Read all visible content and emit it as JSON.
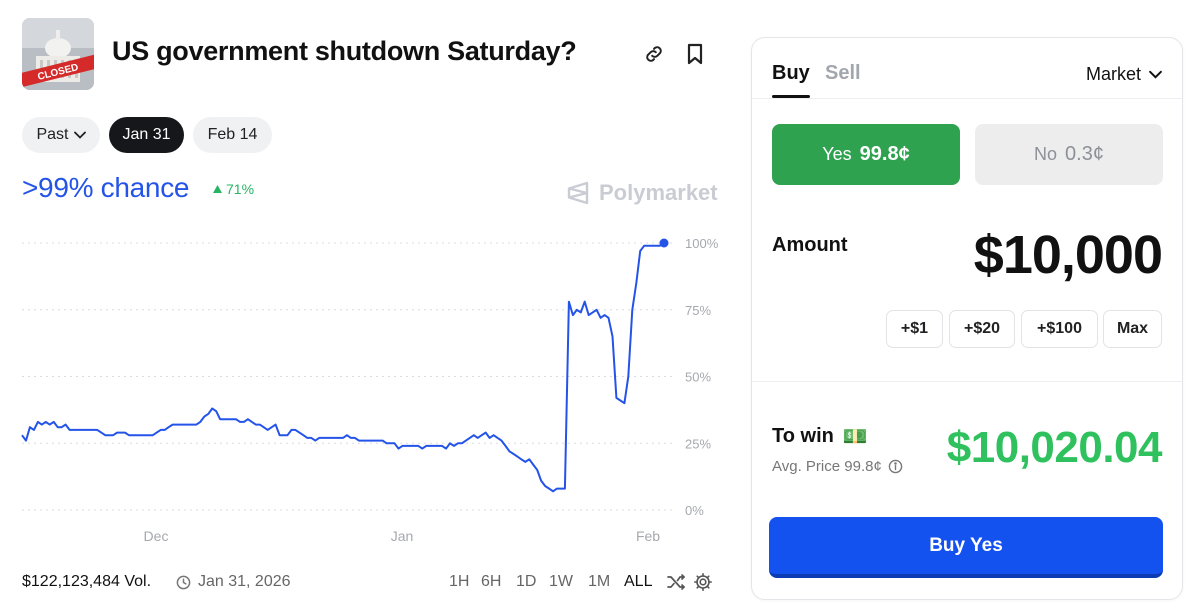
{
  "market": {
    "title": "US government shutdown Saturday?",
    "thumbnail_stamp": "CLOSED"
  },
  "date_pills": [
    {
      "label": "Past",
      "has_dropdown": true,
      "active": false
    },
    {
      "label": "Jan 31",
      "active": true
    },
    {
      "label": "Feb 14",
      "active": false
    }
  ],
  "probability": {
    "chance_text": ">99% chance",
    "change_text": "71%",
    "change_direction": "up"
  },
  "watermark": "Polymarket",
  "chart_data": {
    "type": "line",
    "x_ticks": [
      "Dec",
      "Jan",
      "Feb"
    ],
    "y_ticks": [
      "100%",
      "75%",
      "50%",
      "25%",
      "0%"
    ],
    "ylim": [
      0,
      100
    ],
    "grid": true,
    "legend": "none",
    "series": [
      {
        "color": "#2453e8",
        "values": [
          28,
          26,
          31,
          30,
          33,
          32,
          33,
          32,
          33,
          31,
          31,
          32,
          30,
          30,
          30,
          30,
          30,
          30,
          30,
          30,
          29,
          28,
          28,
          28,
          29,
          29,
          29,
          28,
          28,
          28,
          28,
          28,
          28,
          28,
          29,
          30,
          30,
          31,
          32,
          32,
          32,
          32,
          32,
          32,
          32,
          33,
          35,
          36,
          38,
          37,
          34,
          34,
          34,
          34,
          34,
          33,
          33,
          34,
          33,
          32,
          32,
          31,
          30,
          31,
          32,
          28,
          28,
          28,
          30,
          30,
          29,
          28,
          27,
          27,
          26,
          27,
          27,
          27,
          27,
          27,
          27,
          27,
          28,
          27,
          27,
          26,
          26,
          26,
          26,
          26,
          26,
          26,
          25,
          25,
          25,
          23,
          24,
          24,
          24,
          24,
          24,
          23,
          24,
          24,
          24,
          24,
          24,
          23,
          25,
          24,
          25,
          25,
          26,
          27,
          28,
          27,
          28,
          29,
          27,
          28,
          27,
          26,
          24,
          22,
          21,
          20,
          19,
          18,
          19,
          17,
          15,
          11,
          9,
          8,
          7,
          8,
          8,
          8,
          78,
          73,
          75,
          74,
          78,
          73,
          74,
          75,
          72,
          73,
          72,
          65,
          42,
          41,
          40,
          50,
          75,
          85,
          97,
          99,
          99,
          99,
          99,
          99,
          100
        ]
      }
    ]
  },
  "footer": {
    "volume": "$122,123,484 Vol.",
    "date": "Jan 31, 2026",
    "ranges": [
      "1H",
      "6H",
      "1D",
      "1W",
      "1M",
      "ALL"
    ],
    "active_range": "ALL"
  },
  "trade_panel": {
    "tabs": {
      "buy": "Buy",
      "sell": "Sell"
    },
    "active_tab": "Buy",
    "order_type": "Market",
    "yes_label": "Yes",
    "yes_price": "99.8¢",
    "no_label": "No",
    "no_price": "0.3¢",
    "amount_label": "Amount",
    "amount_value": "$10,000",
    "quick_add": [
      "+$1",
      "+$20",
      "+$100",
      "Max"
    ],
    "to_win_label": "To win",
    "to_win_emoji": "💵",
    "avg_price": "Avg. Price 99.8¢",
    "to_win_value": "$10,020.04",
    "buy_button": "Buy Yes"
  },
  "colors": {
    "accent_blue": "#2453e8",
    "yes_green": "#2fa24f",
    "win_green": "#2fc15d",
    "buy_button": "#1452f0",
    "delta_green": "#28b463"
  },
  "icons": {
    "link": "link-icon",
    "bookmark": "bookmark-icon",
    "dropdown": "chevron-down-icon",
    "delta": "triangle-up-icon",
    "clock": "clock-icon",
    "shuffle": "shuffle-icon",
    "settings": "gear-icon",
    "info": "info-icon",
    "brand": "polymarket-logo-icon"
  }
}
